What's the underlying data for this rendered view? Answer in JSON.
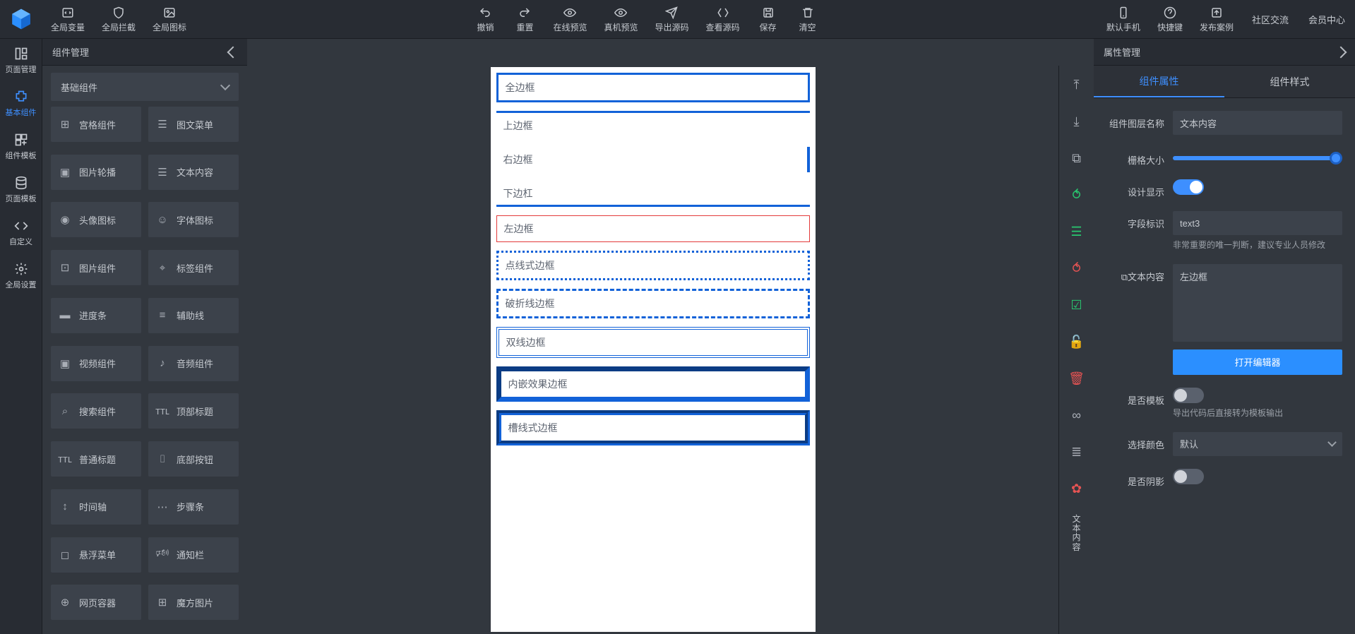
{
  "topbar": {
    "left": [
      {
        "label": "全局变量",
        "icon": "code-icon"
      },
      {
        "label": "全局拦截",
        "icon": "shield-icon"
      },
      {
        "label": "全局图标",
        "icon": "image-icon"
      }
    ],
    "center": [
      {
        "label": "撤销",
        "icon": "undo-icon"
      },
      {
        "label": "重置",
        "icon": "redo-icon"
      },
      {
        "label": "在线预览",
        "icon": "eye-icon"
      },
      {
        "label": "真机预览",
        "icon": "eye-icon"
      },
      {
        "label": "导出源码",
        "icon": "send-icon"
      },
      {
        "label": "查看源码",
        "icon": "brackets-icon"
      },
      {
        "label": "保存",
        "icon": "save-icon"
      },
      {
        "label": "清空",
        "icon": "trash-icon"
      }
    ],
    "right": [
      {
        "label": "默认手机",
        "icon": "phone-icon"
      },
      {
        "label": "快捷键",
        "icon": "help-icon"
      },
      {
        "label": "发布案例",
        "icon": "publish-icon"
      }
    ],
    "links": [
      "社区交流",
      "会员中心"
    ]
  },
  "leftnav": [
    {
      "label": "页面管理",
      "icon": "layout-icon"
    },
    {
      "label": "基本组件",
      "icon": "puzzle-icon",
      "active": true
    },
    {
      "label": "组件模板",
      "icon": "grid-plus-icon"
    },
    {
      "label": "页面模板",
      "icon": "db-icon"
    },
    {
      "label": "自定义",
      "icon": "code2-icon"
    },
    {
      "label": "全局设置",
      "icon": "gear-icon"
    }
  ],
  "compPanel": {
    "title": "组件管理",
    "category": "基础组件",
    "items": [
      {
        "label": "宫格组件",
        "glyph": "⊞"
      },
      {
        "label": "图文菜单",
        "glyph": "☰"
      },
      {
        "label": "图片轮播",
        "glyph": "▣"
      },
      {
        "label": "文本内容",
        "glyph": "☰"
      },
      {
        "label": "头像图标",
        "glyph": "◉"
      },
      {
        "label": "字体图标",
        "glyph": "☺"
      },
      {
        "label": "图片组件",
        "glyph": "⊡"
      },
      {
        "label": "标签组件",
        "glyph": "⌖"
      },
      {
        "label": "进度条",
        "glyph": "▬"
      },
      {
        "label": "辅助线",
        "glyph": "≡"
      },
      {
        "label": "视频组件",
        "glyph": "▣"
      },
      {
        "label": "音频组件",
        "glyph": "♪"
      },
      {
        "label": "搜索组件",
        "glyph": "⌕"
      },
      {
        "label": "顶部标题",
        "glyph": "ᴛᴛʟ"
      },
      {
        "label": "普通标题",
        "glyph": "ᴛᴛʟ"
      },
      {
        "label": "底部按钮",
        "glyph": "⌷"
      },
      {
        "label": "时间轴",
        "glyph": "↕"
      },
      {
        "label": "步骤条",
        "glyph": "⋯"
      },
      {
        "label": "悬浮菜单",
        "glyph": "◻"
      },
      {
        "label": "通知栏",
        "glyph": "🕬"
      },
      {
        "label": "网页容器",
        "glyph": "⊕"
      },
      {
        "label": "魔方图片",
        "glyph": "⊞"
      }
    ]
  },
  "canvas": {
    "rows": [
      {
        "text": "全边框",
        "cls": "full"
      },
      {
        "text": "上边框",
        "cls": "top"
      },
      {
        "text": "右边框",
        "cls": "right"
      },
      {
        "text": "下边杠",
        "cls": "bottom"
      },
      {
        "text": "左边框",
        "cls": "left"
      },
      {
        "text": "点线式边框",
        "cls": "dotted"
      },
      {
        "text": "破折线边框",
        "cls": "dashed"
      },
      {
        "text": "双线边框",
        "cls": "double"
      },
      {
        "text": "内嵌效果边框",
        "cls": "inset"
      },
      {
        "text": "槽线式边框",
        "cls": "groove"
      }
    ]
  },
  "rail": [
    {
      "name": "align-top-icon",
      "glyph": "⤒",
      "cls": ""
    },
    {
      "name": "align-bottom-icon",
      "glyph": "⤓",
      "cls": ""
    },
    {
      "name": "copy-icon",
      "glyph": "⧉",
      "cls": ""
    },
    {
      "name": "puzzle-icon",
      "glyph": "⥀",
      "cls": "green"
    },
    {
      "name": "doc-icon",
      "glyph": "☰",
      "cls": "green"
    },
    {
      "name": "puzzle2-icon",
      "glyph": "⥀",
      "cls": "red"
    },
    {
      "name": "doc-check-icon",
      "glyph": "☑",
      "cls": "green"
    },
    {
      "name": "lock-icon",
      "glyph": "🔓",
      "cls": ""
    },
    {
      "name": "delete-icon",
      "glyph": "🗑",
      "cls": "red"
    },
    {
      "name": "link-icon",
      "glyph": "∞",
      "cls": ""
    },
    {
      "name": "layers-icon",
      "glyph": "≣",
      "cls": ""
    },
    {
      "name": "gear-icon",
      "glyph": "✿",
      "cls": "red"
    }
  ],
  "railText": "文本内容",
  "propPanel": {
    "title": "属性管理",
    "tabs": [
      "组件属性",
      "组件样式"
    ],
    "layerName": {
      "label": "组件图层名称",
      "value": "文本内容"
    },
    "gridSize": {
      "label": "栅格大小"
    },
    "designShow": {
      "label": "设计显示",
      "on": true
    },
    "fieldId": {
      "label": "字段标识",
      "value": "text3",
      "hint": "非常重要的唯一判断，建议专业人员修改"
    },
    "textContent": {
      "label": "文本内容",
      "value": "左边框",
      "button": "打开编辑器"
    },
    "isTemplate": {
      "label": "是否模板",
      "on": false,
      "hint": "导出代码后直接转为模板输出"
    },
    "selectColor": {
      "label": "选择颜色",
      "value": "默认"
    },
    "hasShadow": {
      "label": "是否阴影",
      "on": false
    },
    "iconPrefix": "⧉"
  }
}
